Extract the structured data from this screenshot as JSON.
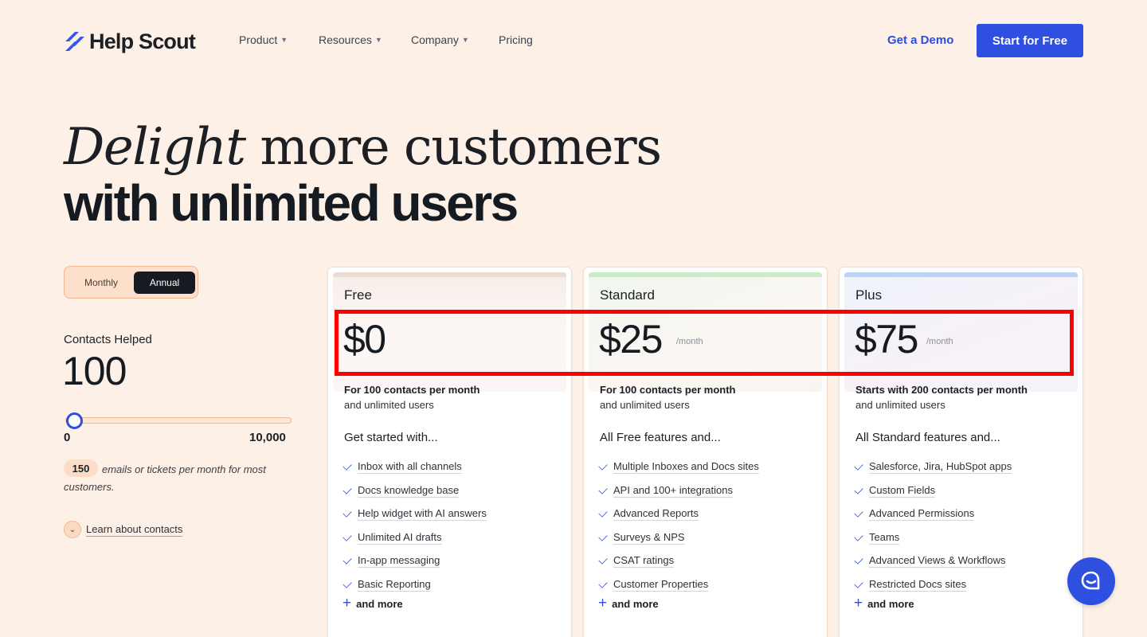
{
  "header": {
    "logo_text": "Help Scout",
    "nav": [
      {
        "label": "Product",
        "has_menu": true
      },
      {
        "label": "Resources",
        "has_menu": true
      },
      {
        "label": "Company",
        "has_menu": true
      },
      {
        "label": "Pricing",
        "has_menu": false
      }
    ],
    "demo_label": "Get a Demo",
    "start_label": "Start for Free"
  },
  "hero": {
    "line1_em": "Delight",
    "line1_rest": "more customers",
    "line2": "with unlimited users"
  },
  "billing_toggle": {
    "options": [
      "Monthly",
      "Annual"
    ],
    "selected": "Annual"
  },
  "contacts": {
    "label": "Contacts Helped",
    "value": "100",
    "slider_min": "0",
    "slider_max": "10,000",
    "slider_fraction": 0.0,
    "emails_count": "150",
    "emails_text": "emails or tickets per month for most customers.",
    "learn_label": "Learn about contacts"
  },
  "plans": [
    {
      "name": "Free",
      "price": "$0",
      "period": "",
      "desc_bold": "For 100 contacts per month",
      "desc": "and unlimited users",
      "features_heading": "Get started with...",
      "features": [
        "Inbox with all channels",
        "Docs knowledge base",
        "Help widget with AI answers",
        "Unlimited AI drafts",
        "In-app messaging",
        "Basic Reporting"
      ],
      "more_label": "and more"
    },
    {
      "name": "Standard",
      "price": "$25",
      "period": "/month",
      "desc_bold": "For 100 contacts per month",
      "desc": "and unlimited users",
      "features_heading": "All Free features and...",
      "features": [
        "Multiple Inboxes and Docs sites",
        "API and 100+ integrations",
        "Advanced Reports",
        "Surveys & NPS",
        "CSAT ratings",
        "Customer Properties"
      ],
      "more_label": "and more"
    },
    {
      "name": "Plus",
      "price": "$75",
      "period": "/month",
      "desc_bold": "Starts with 200 contacts per month",
      "desc": "and unlimited users",
      "features_heading": "All Standard features and...",
      "features": [
        "Salesforce, Jira, HubSpot apps",
        "Custom Fields",
        "Advanced Permissions",
        "Teams",
        "Advanced Views & Workflows",
        "Restricted Docs sites"
      ],
      "more_label": "and more"
    }
  ],
  "colors": {
    "background": "#fdf0e6",
    "accent": "#2e4fe0",
    "dark": "#161b22",
    "highlight": "#ff0000"
  },
  "icons": [
    "logo-mark-icon",
    "chevron-down-icon",
    "check-icon",
    "plus-icon",
    "chat-icon"
  ]
}
